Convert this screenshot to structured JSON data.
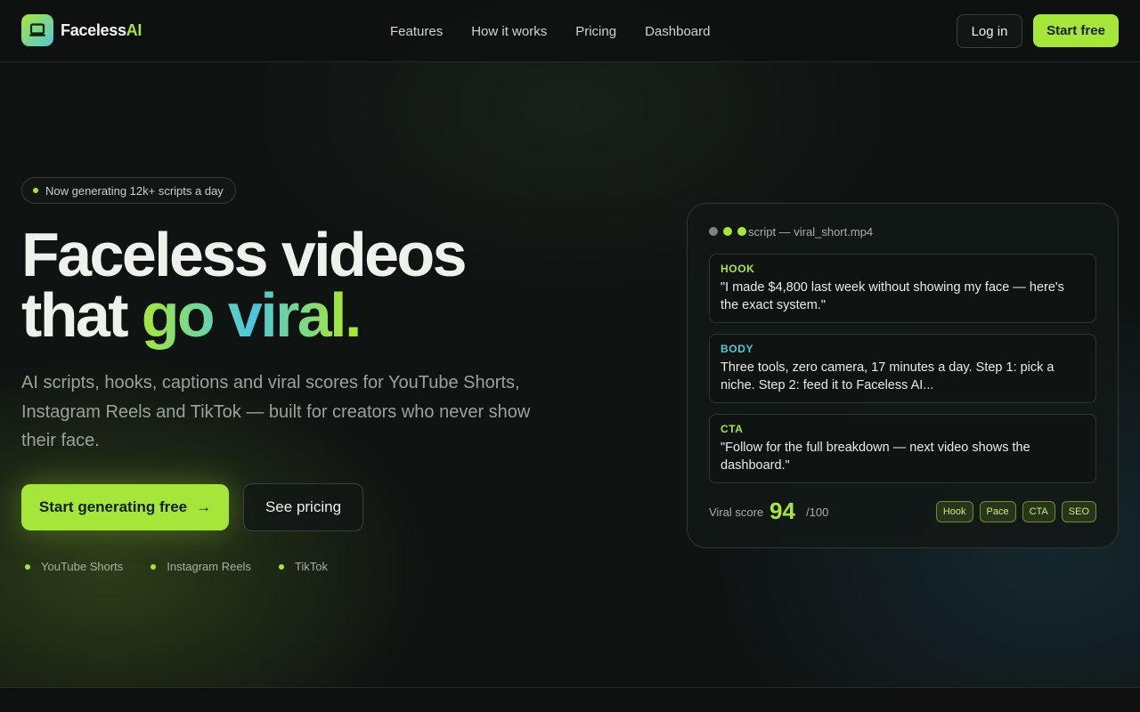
{
  "nav": {
    "brand_main": "Faceless",
    "brand_accent": "AI",
    "links": [
      "Features",
      "How it works",
      "Pricing",
      "Dashboard"
    ],
    "login_label": "Log in",
    "start_label": "Start free"
  },
  "hero": {
    "badge": "Now generating 12k+ scripts a day",
    "headline_line1": "Faceless videos",
    "headline_line2_plain": "that ",
    "headline_line2_gradient": "go viral",
    "headline_period": ".",
    "subtitle": "AI scripts, hooks, captions and viral scores for YouTube Shorts, Instagram Reels and TikTok — built for creators who never show their face.",
    "cta_primary": "Start generating free",
    "cta_primary_arrow": "→",
    "cta_secondary": "See pricing",
    "platforms": [
      "YouTube Shorts",
      "Instagram Reels",
      "TikTok"
    ]
  },
  "card": {
    "title": "script — viral_short.mp4",
    "blocks": [
      {
        "label": "HOOK",
        "text": "\"I made $4,800 last week without showing my face — here's the exact system.\"",
        "color": "#a6e63a"
      },
      {
        "label": "BODY",
        "text": "Three tools, zero camera, 17 minutes a day. Step 1: pick a niche. Step 2: feed it to Faceless AI...",
        "color": "#52c7d9"
      },
      {
        "label": "CTA",
        "text": "\"Follow for the full breakdown — next video shows the dashboard.\"",
        "color": "#a6e63a"
      }
    ],
    "score_label": "Viral score",
    "score_value": "94",
    "score_max": "/100",
    "chips": [
      "Hook",
      "Pace",
      "CTA",
      "SEO"
    ]
  },
  "colors": {
    "accent": "#a6e63a",
    "cyan": "#52c7d9",
    "background": "#0f1312"
  }
}
